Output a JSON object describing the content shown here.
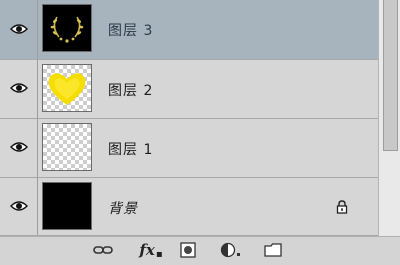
{
  "layers": [
    {
      "name": "图层 3",
      "selected": true,
      "thumbnail": "dark-wreath",
      "locked": false
    },
    {
      "name": "图层 2",
      "selected": false,
      "thumbnail": "yellow-heart",
      "locked": false
    },
    {
      "name": "图层 1",
      "selected": false,
      "thumbnail": "transparent",
      "locked": false
    },
    {
      "name": "背景",
      "selected": false,
      "thumbnail": "black-fill",
      "locked": true
    }
  ],
  "footer": {
    "fx_label": "fx",
    "icons": [
      "link-layers-icon",
      "layer-style-icon",
      "layer-mask-icon",
      "adjustment-layer-icon",
      "new-group-icon"
    ]
  },
  "colors": {
    "selected_row": "#a7b3bd",
    "row": "#d6d6d6",
    "heart": "#f6de00",
    "wreath": "#c8b44a"
  }
}
